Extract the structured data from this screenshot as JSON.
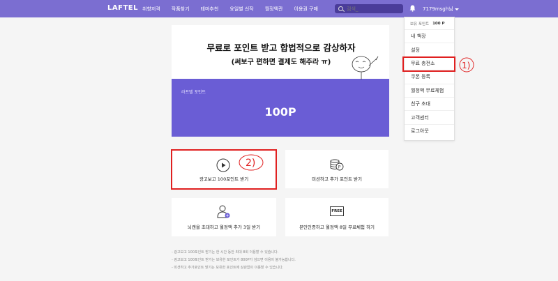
{
  "header": {
    "logo": "LAFTEL",
    "nav": [
      "취향저격",
      "작품찾기",
      "테마추천",
      "요일별 신작",
      "월정액관",
      "이용권 구매"
    ],
    "search_placeholder": "검색_",
    "user_name": "7179msgh님"
  },
  "dropdown": {
    "points_label": "보유 포인트",
    "points_value": "100 P",
    "items": [
      "내 책장",
      "설정",
      "무료 충전소",
      "쿠폰 등록",
      "월정액 무료체험",
      "친구 초대",
      "고객센터",
      "로그아웃"
    ]
  },
  "banner": {
    "headline": "무료로 포인트 받고 합법적으로 감상하자",
    "subline": "(써보구 편하면 결제도 해주라 ㅠ)",
    "points_label": "라프텔 포인트",
    "points_value": "100P"
  },
  "cards": {
    "ad_label": "광고보고 100포인트 받기",
    "mission_label": "미션하고 추가 포인트 받기",
    "invite_label": "뇌캔을 초대하고 월정액 추가 3일 받기",
    "free_label": "본인인증하고 월정액 8일 무료체험 하기",
    "free_badge": "FREE"
  },
  "annotations": {
    "mark1": "1)",
    "mark2": "2)"
  },
  "notes": [
    "- 광고보고 100포인트 받기는 한 시간 동안 최대 8회 이용할 수 있습니다.",
    "- 광고보고 100포인트 받기는 보유한 포인트가 800P가 넘으면 이용이 불가능합니다.",
    "- 미션하고 추가포인트 받기는 보유한 포인트에 상관없이 이용할 수 있습니다."
  ],
  "colors": {
    "brand": "#7b6ed1",
    "banner_purple": "#6a5dd5",
    "annotation_red": "#e02020"
  }
}
